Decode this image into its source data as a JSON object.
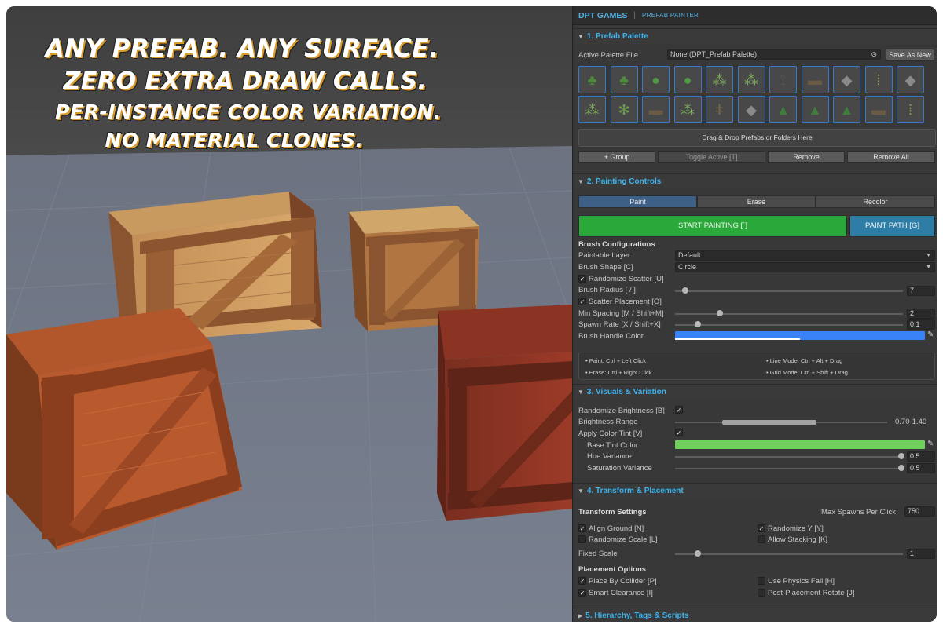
{
  "promo": {
    "line1": "ANY PREFAB. ANY SURFACE.",
    "line2": "ZERO EXTRA DRAW CALLS.",
    "line3": "PER-INSTANCE COLOR VARIATION.",
    "line4": "NO MATERIAL CLONES."
  },
  "header": {
    "brand": "DPT GAMES",
    "separator": "|",
    "tool": "PREFAB PAINTER"
  },
  "sections": {
    "palette": "1. Prefab Palette",
    "painting": "2. Painting Controls",
    "visuals": "3. Visuals & Variation",
    "transform": "4. Transform & Placement",
    "hierarchy": "5. Hierarchy, Tags & Scripts"
  },
  "palette": {
    "file_label": "Active Palette File",
    "file_value": "None (DPT_Prefab Palette)",
    "save_button": "Save As New",
    "dropzone": "Drag & Drop Prefabs or Folders Here",
    "buttons": [
      "+ Group",
      "Toggle Active [T]",
      "Remove",
      "Remove All"
    ],
    "thumbnails": [
      "tree-icon",
      "tree-icon",
      "bush-icon",
      "bush-icon",
      "grass-icon",
      "grass-icon",
      "dead-tree-icon",
      "stump-icon",
      "rock-icon",
      "reeds-icon",
      "rock-icon",
      "grass-icon",
      "fern-icon",
      "stump-icon",
      "grass-icon",
      "sapling-icon",
      "rock-icon",
      "pine-icon",
      "pine-icon",
      "pine-icon",
      "stump-icon",
      "reeds-icon"
    ]
  },
  "painting": {
    "modes": [
      "Paint",
      "Erase",
      "Recolor"
    ],
    "start_button": "START PAINTING [`]",
    "path_button": "PAINT PATH [G]",
    "brush_heading": "Brush Configurations",
    "paintable_layer_label": "Paintable Layer",
    "paintable_layer_value": "Default",
    "brush_shape_label": "Brush Shape [C]",
    "brush_shape_value": "Circle",
    "randomize_scatter": "Randomize Scatter [U]",
    "brush_radius_label": "Brush Radius [ / ]",
    "brush_radius_value": "7",
    "scatter_placement": "Scatter Placement [O]",
    "min_spacing_label": "Min Spacing [M / Shift+M]",
    "min_spacing_value": "2",
    "spawn_rate_label": "Spawn Rate [X / Shift+X]",
    "spawn_rate_value": "0.1",
    "handle_color_label": "Brush Handle Color",
    "handle_color": "#3a82f7",
    "help": {
      "paint": "• Paint: Ctrl + Left Click",
      "erase": "• Erase: Ctrl + Right Click",
      "line": "• Line Mode: Ctrl + Alt + Drag",
      "grid": "• Grid Mode: Ctrl + Shift + Drag"
    }
  },
  "visuals": {
    "randomize_brightness": "Randomize Brightness [B]",
    "brightness_range_label": "Brightness Range",
    "brightness_range_value": "0.70-1.40",
    "apply_tint": "Apply Color Tint [V]",
    "base_tint_label": "Base Tint Color",
    "base_tint": "#6fd15c",
    "hue_label": "Hue Variance",
    "hue_value": "0.5",
    "saturation_label": "Saturation Variance",
    "saturation_value": "0.5"
  },
  "transform": {
    "settings_heading": "Transform Settings",
    "max_spawns_label": "Max Spawns Per Click",
    "max_spawns_value": "750",
    "align_ground": "Align Ground [N]",
    "randomize_y": "Randomize Y [Y]",
    "randomize_scale": "Randomize Scale [L]",
    "allow_stacking": "Allow Stacking [K]",
    "fixed_scale_label": "Fixed Scale",
    "fixed_scale_value": "1",
    "placement_heading": "Placement Options",
    "place_by_collider": "Place By Collider [P]",
    "use_physics_fall": "Use Physics Fall [H]",
    "smart_clearance": "Smart Clearance [I]",
    "post_rotate": "Post-Placement Rotate [J]"
  },
  "colors": {
    "accent": "#3db4ee",
    "start": "#2aa83a",
    "path": "#2e7da6",
    "active_mode": "#3e5f86"
  }
}
